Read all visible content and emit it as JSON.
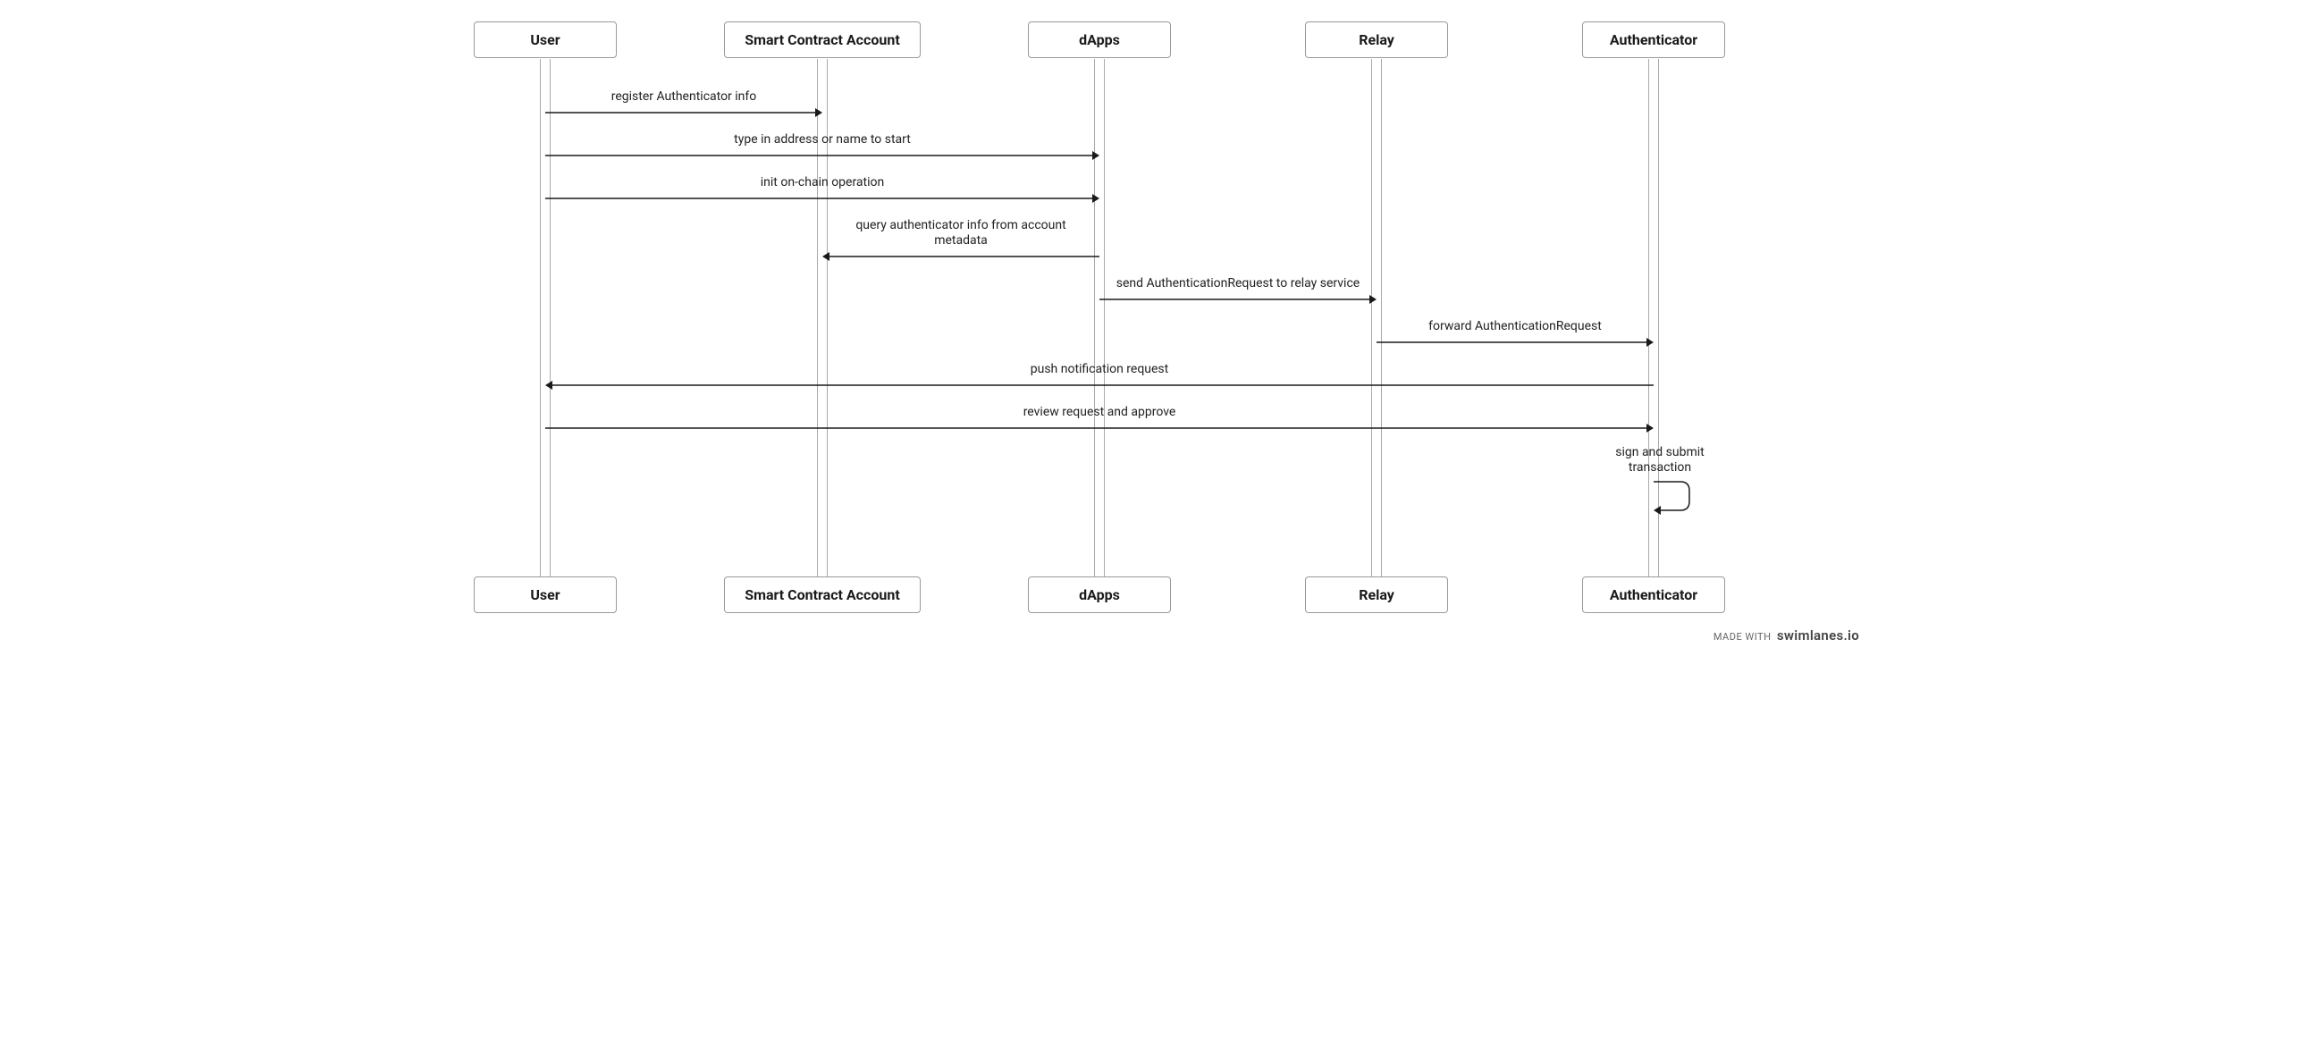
{
  "chart_data": {
    "type": "sequence-diagram",
    "participants": [
      "User",
      "Smart Contract Account",
      "dApps",
      "Relay",
      "Authenticator"
    ],
    "messages": [
      {
        "from": "User",
        "to": "Smart Contract Account",
        "text": "register Authenticator info"
      },
      {
        "from": "User",
        "to": "dApps",
        "text": "type in address or name to start"
      },
      {
        "from": "User",
        "to": "dApps",
        "text": "init on-chain operation"
      },
      {
        "from": "dApps",
        "to": "Smart Contract Account",
        "text": "query authenticator info from account metadata"
      },
      {
        "from": "dApps",
        "to": "Relay",
        "text": "send AuthenticationRequest to relay service"
      },
      {
        "from": "Relay",
        "to": "Authenticator",
        "text": "forward AuthenticationRequest"
      },
      {
        "from": "Authenticator",
        "to": "User",
        "text": "push notification request"
      },
      {
        "from": "User",
        "to": "Authenticator",
        "text": "review request and approve"
      },
      {
        "from": "Authenticator",
        "to": "Authenticator",
        "text": "sign and submit transaction"
      }
    ]
  },
  "participants": {
    "p0": "User",
    "p1": "Smart Contract Account",
    "p2": "dApps",
    "p3": "Relay",
    "p4": "Authenticator"
  },
  "messages": {
    "m0": "register Authenticator info",
    "m1": "type in address or name to start",
    "m2": "init on-chain operation",
    "m3": "query authenticator info from account\nmetadata",
    "m3a": "query authenticator info from account",
    "m3b": "metadata",
    "m4": "send AuthenticationRequest to relay service",
    "m5": "forward AuthenticationRequest",
    "m6": "push notification request",
    "m7": "review request and approve",
    "m8a": "sign and submit",
    "m8b": "transaction"
  },
  "watermark": {
    "prefix": "MADE WITH",
    "brand": "swimlanes.io"
  }
}
